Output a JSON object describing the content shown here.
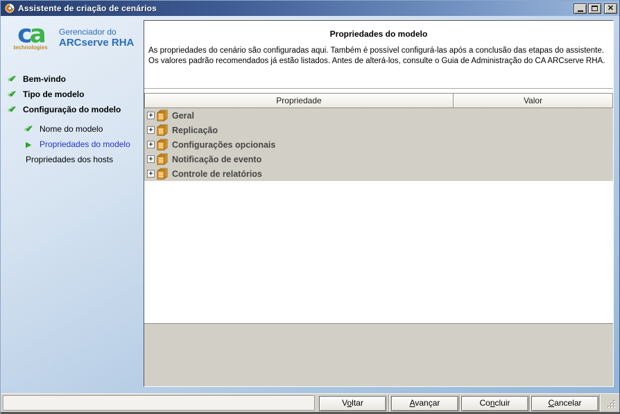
{
  "window": {
    "title": "Assistente de criação de cenários",
    "controls": {
      "minimize": "minimize",
      "maximize": "maximize",
      "close": "close"
    }
  },
  "branding": {
    "logo_c": "c",
    "logo_a": "a",
    "logo_sub": "technologies",
    "product_line1": "Gerenciador do",
    "product_line2": "ARCserve RHA"
  },
  "sidebar": {
    "steps": [
      {
        "label": "Bem-vindo",
        "state": "done",
        "level": 0,
        "icon": "check-icon"
      },
      {
        "label": "Tipo de modelo",
        "state": "done",
        "level": 0,
        "icon": "check-icon"
      },
      {
        "label": "Configuração do modelo",
        "state": "done",
        "level": 0,
        "icon": "check-icon"
      },
      {
        "label": "Nome do modelo",
        "state": "done",
        "level": 1,
        "icon": "check-icon"
      },
      {
        "label": "Propriedades do modelo",
        "state": "current",
        "level": 1,
        "icon": "arrow-icon"
      },
      {
        "label": "Propriedades dos hosts",
        "state": "pending",
        "level": 1,
        "icon": null
      }
    ]
  },
  "main": {
    "title": "Propriedades do modelo",
    "description_line1": "As propriedades do cenário são configuradas aqui. Também é possível configurá-las após a conclusão das etapas do assistente.",
    "description_line2": "Os valores padrão recomendados já estão listados. Antes de alterá-los, consulte o Guia de Administração do CA ARCserve RHA.",
    "table": {
      "columns": {
        "property": "Propriedade",
        "value": "Valor"
      },
      "expand_glyph": "+",
      "rows": [
        {
          "label": "Geral",
          "value": ""
        },
        {
          "label": "Replicação",
          "value": ""
        },
        {
          "label": "Configurações opcionais",
          "value": ""
        },
        {
          "label": "Notificação de evento",
          "value": ""
        },
        {
          "label": "Controle de relatórios",
          "value": ""
        }
      ]
    }
  },
  "footer": {
    "status_text": "",
    "buttons": [
      {
        "name": "voltar",
        "pre": "V",
        "key": "o",
        "post": "ltar"
      },
      {
        "name": "avancar",
        "pre": "",
        "key": "A",
        "post": "vançar"
      },
      {
        "name": "concluir",
        "pre": "Co",
        "key": "n",
        "post": "cluir"
      },
      {
        "name": "cancelar",
        "pre": "",
        "key": "C",
        "post": "ancelar"
      }
    ]
  },
  "colors": {
    "titlebar_gradient_start": "#29406f",
    "titlebar_gradient_end": "#9db9dd",
    "brand_blue": "#2a6ebb",
    "brand_green": "#3db44a",
    "technologies_amber": "#c08a28",
    "current_step_blue": "#2433cc",
    "check_green": "#2da32d",
    "tree_icon_orange": "#f0a22c",
    "panel_gray": "#d2cfc6"
  }
}
